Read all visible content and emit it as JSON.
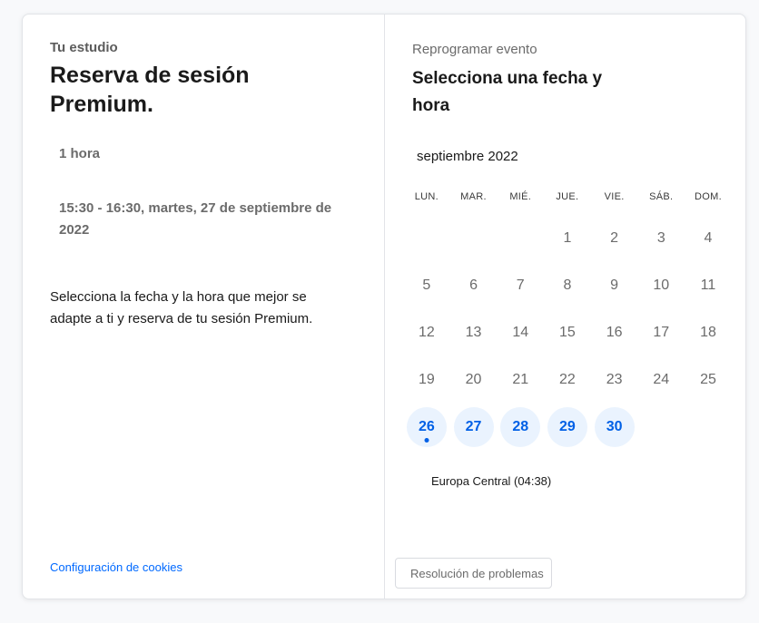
{
  "left": {
    "org_name": "Tu estudio",
    "event_title": "Reserva de sesión Premium.",
    "duration": "1 hora",
    "datetime": "15:30 - 16:30, martes, 27 de septiembre de 2022",
    "description": "Selecciona la fecha y la hora que mejor se adapte a ti y reserva de tu sesión Premium.",
    "cookies_link": "Configuración de cookies"
  },
  "right": {
    "reschedule_label": "Reprogramar evento",
    "select_title": "Selecciona una fecha y hora",
    "month": "septiembre 2022",
    "weekdays": [
      "LUN.",
      "MAR.",
      "MIÉ.",
      "JUE.",
      "VIE.",
      "SÁB.",
      "DOM."
    ],
    "days": [
      {
        "n": "",
        "avail": false
      },
      {
        "n": "",
        "avail": false
      },
      {
        "n": "",
        "avail": false
      },
      {
        "n": "1",
        "avail": false
      },
      {
        "n": "2",
        "avail": false
      },
      {
        "n": "3",
        "avail": false
      },
      {
        "n": "4",
        "avail": false
      },
      {
        "n": "5",
        "avail": false
      },
      {
        "n": "6",
        "avail": false
      },
      {
        "n": "7",
        "avail": false
      },
      {
        "n": "8",
        "avail": false
      },
      {
        "n": "9",
        "avail": false
      },
      {
        "n": "10",
        "avail": false
      },
      {
        "n": "11",
        "avail": false
      },
      {
        "n": "12",
        "avail": false
      },
      {
        "n": "13",
        "avail": false
      },
      {
        "n": "14",
        "avail": false
      },
      {
        "n": "15",
        "avail": false
      },
      {
        "n": "16",
        "avail": false
      },
      {
        "n": "17",
        "avail": false
      },
      {
        "n": "18",
        "avail": false
      },
      {
        "n": "19",
        "avail": false
      },
      {
        "n": "20",
        "avail": false
      },
      {
        "n": "21",
        "avail": false
      },
      {
        "n": "22",
        "avail": false
      },
      {
        "n": "23",
        "avail": false
      },
      {
        "n": "24",
        "avail": false
      },
      {
        "n": "25",
        "avail": false
      },
      {
        "n": "26",
        "avail": true,
        "today": true
      },
      {
        "n": "27",
        "avail": true
      },
      {
        "n": "28",
        "avail": true
      },
      {
        "n": "29",
        "avail": true
      },
      {
        "n": "30",
        "avail": true
      }
    ],
    "timezone": "Europa Central (04:38)",
    "trouble_button": "Resolución de problemas"
  },
  "colors": {
    "accent": "#0060e6",
    "link": "#0069ff",
    "available_bg": "#eaf3fe"
  }
}
